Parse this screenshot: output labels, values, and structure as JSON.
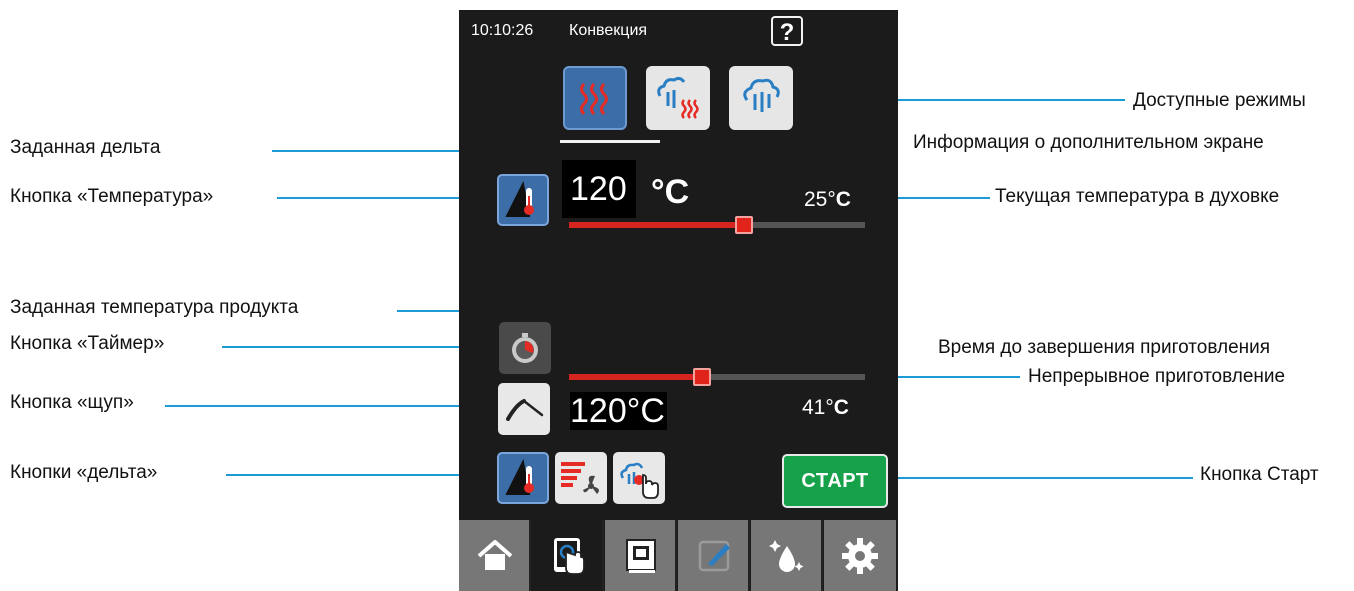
{
  "status_bar": {
    "time": "10:10:26",
    "mode_name": "Конвекция",
    "help_label": "?"
  },
  "modes": [
    {
      "icon": "heat-waves-icon",
      "active": true
    },
    {
      "icon": "steam-heat-icon",
      "active": false
    },
    {
      "icon": "steam-icon",
      "active": false
    }
  ],
  "temperature": {
    "set_value": "120",
    "unit": "°C",
    "current_value": "25°",
    "current_unit": "C",
    "slider_fraction": 0.59
  },
  "probe": {
    "set_value": "120°C",
    "current_value": "41°",
    "current_unit": "C",
    "slider_fraction": 0.45
  },
  "start_label": "СТАРТ",
  "nav": [
    {
      "icon": "home-icon",
      "active": false
    },
    {
      "icon": "touch-tablet-icon",
      "active": true
    },
    {
      "icon": "recipe-book-icon",
      "active": false
    },
    {
      "icon": "edit-icon",
      "active": false
    },
    {
      "icon": "cleaning-icon",
      "active": false
    },
    {
      "icon": "gear-icon",
      "active": false
    }
  ],
  "annotations": {
    "available_modes": "Доступные режимы",
    "extra_screen_info": "Информация о дополнительном экране",
    "set_delta": "Заданная дельта",
    "temperature_button": "Кнопка «Температура»",
    "current_oven_temp": "Текущая температура в духовке",
    "set_product_temp": "Заданная температура продукта",
    "timer_button": "Кнопка «Таймер»",
    "time_to_finish": "Время до завершения приготовления",
    "continuous_cooking": "Непрерывное приготовление",
    "probe_button": "Кнопка «щуп»",
    "delta_buttons": "Кнопки «дельта»",
    "start_button": "Кнопка Старт"
  },
  "colors": {
    "screen_bg": "#1b1b1b",
    "accent_blue": "#3d6da6",
    "slider_red": "#d6251f",
    "start_green": "#16a24a",
    "leader_line": "#1c9ad6"
  }
}
